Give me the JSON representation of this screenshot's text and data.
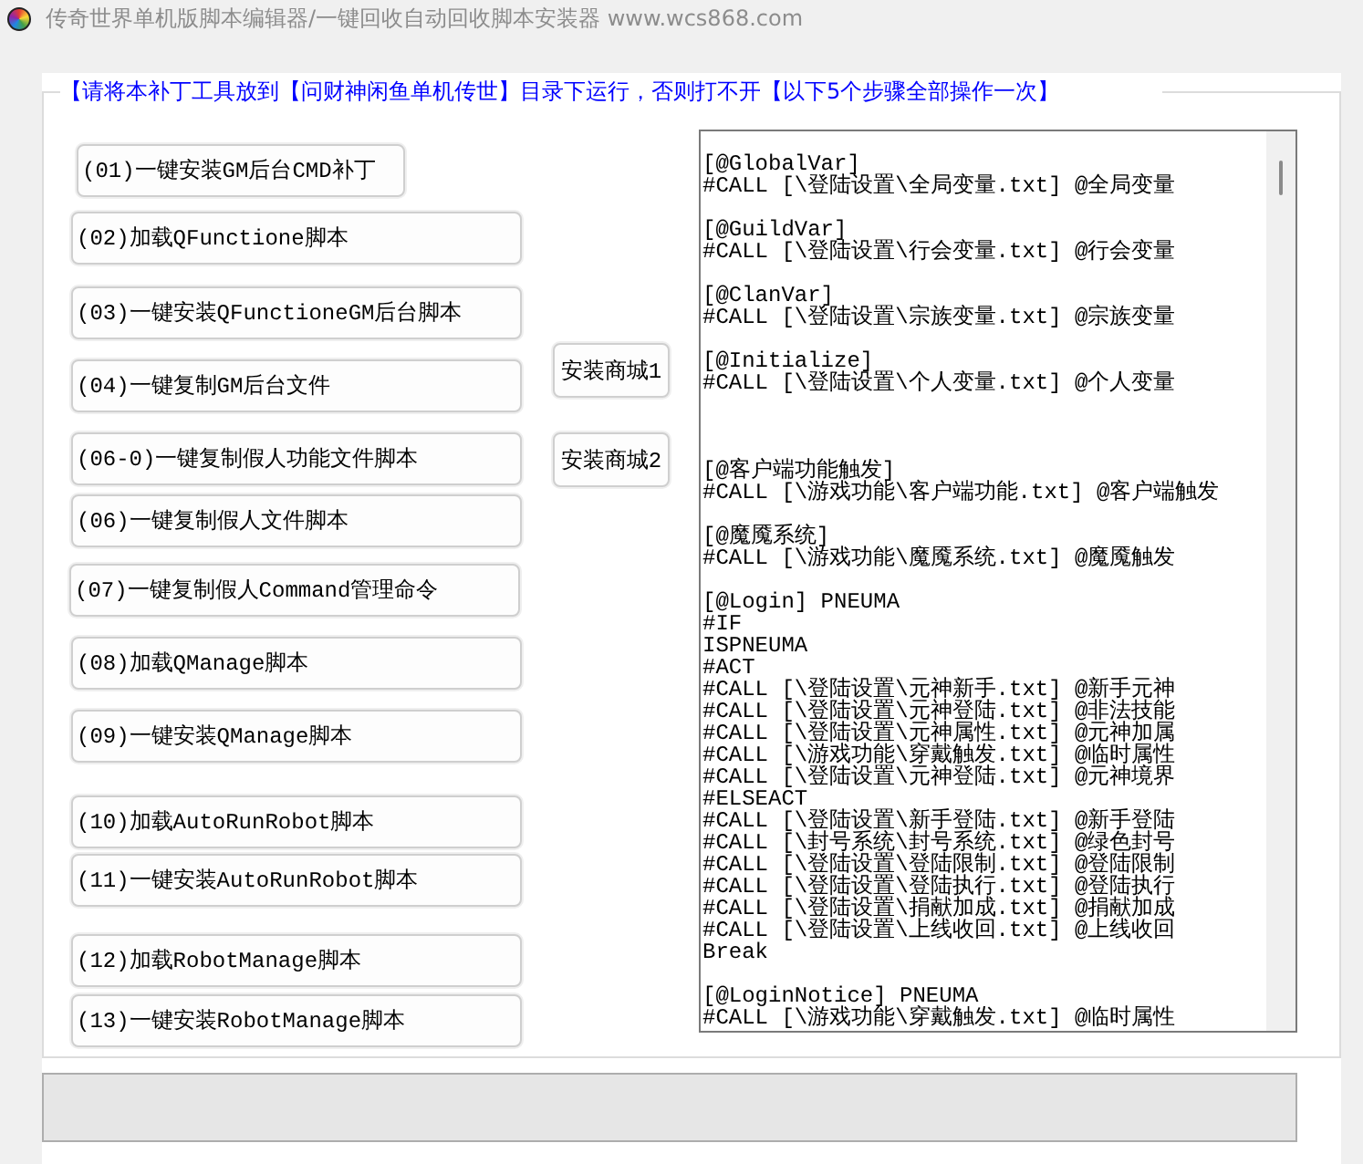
{
  "window": {
    "title": "传奇世界单机版脚本编辑器/一键回收自动回收脚本安装器 www.wcs868.com"
  },
  "group": {
    "notice": "【请将本补丁工具放到【问财神闲鱼单机传世】目录下运行，否则打不开【以下5个步骤全部操作一次】",
    "step_buttons": [
      "(01)一键安装GM后台CMD补丁",
      "(02)加载QFunctione脚本",
      "(03)一键安装QFunctioneGM后台脚本",
      "(04)一键复制GM后台文件",
      "(06-0)一键复制假人功能文件脚本",
      "(06)一键复制假人文件脚本",
      "(07)一键复制假人Command管理命令",
      "(08)加载QManage脚本",
      "(09)一键安装QManage脚本",
      "(10)加载AutoRunRobot脚本",
      "(11)一键安装AutoRunRobot脚本",
      "(12)加载RobotManage脚本",
      "(13)一键安装RobotManage脚本"
    ],
    "shop_buttons": [
      "安装商城1",
      "安装商城2"
    ],
    "script_editor": {
      "value": "[@GlobalVar]\n#CALL [\\登陆设置\\全局变量.txt] @全局变量\n\n[@GuildVar]\n#CALL [\\登陆设置\\行会变量.txt] @行会变量\n\n[@ClanVar]\n#CALL [\\登陆设置\\宗族变量.txt] @宗族变量\n\n[@Initialize]\n#CALL [\\登陆设置\\个人变量.txt] @个人变量\n\n\n\n[@客户端功能触发]\n#CALL [\\游戏功能\\客户端功能.txt] @客户端触发\n\n[@魔魇系统]\n#CALL [\\游戏功能\\魔魇系统.txt] @魔魇触发\n\n[@Login] PNEUMA\n#IF\nISPNEUMA\n#ACT\n#CALL [\\登陆设置\\元神新手.txt] @新手元神\n#CALL [\\登陆设置\\元神登陆.txt] @非法技能\n#CALL [\\登陆设置\\元神属性.txt] @元神加属\n#CALL [\\游戏功能\\穿戴触发.txt] @临时属性\n#CALL [\\登陆设置\\元神登陆.txt] @元神境界\n#ELSEACT\n#CALL [\\登陆设置\\新手登陆.txt] @新手登陆\n#CALL [\\封号系统\\封号系统.txt] @绿色封号\n#CALL [\\登陆设置\\登陆限制.txt] @登陆限制\n#CALL [\\登陆设置\\登陆执行.txt] @登陆执行\n#CALL [\\登陆设置\\捐献加成.txt] @捐献加成\n#CALL [\\登陆设置\\上线收回.txt] @上线收回\nBreak\n\n[@LoginNotice] PNEUMA\n#CALL [\\游戏功能\\穿戴触发.txt] @临时属性"
    }
  }
}
